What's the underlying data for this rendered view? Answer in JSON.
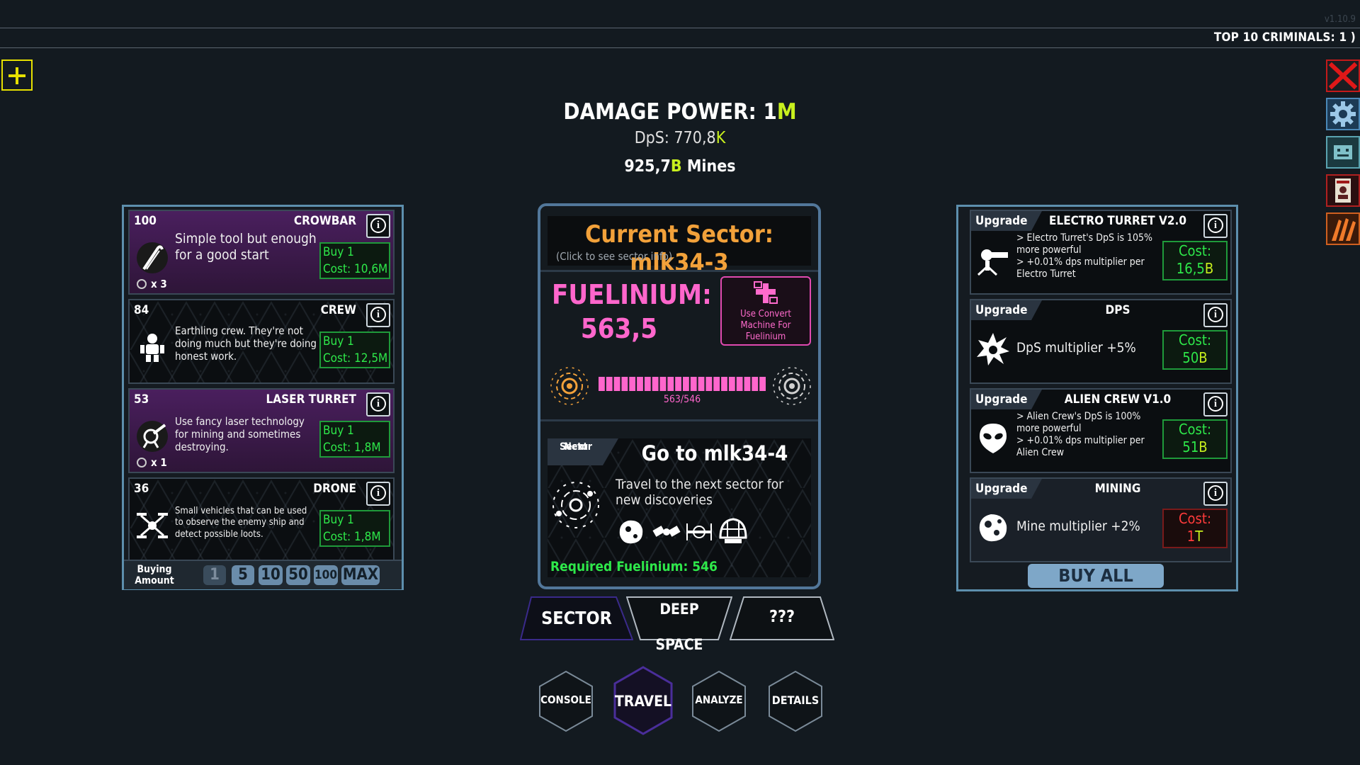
{
  "top_bar": {
    "version": "v1.10.9",
    "top_criminals": "TOP 10 CRIMINALS:  1 )"
  },
  "header": {
    "damage_power_label": "DAMAGE POWER: ",
    "damage_power_value": "1",
    "damage_power_suffix": "M",
    "dps_label": "DpS: ",
    "dps_value": "770,8",
    "dps_suffix": "K",
    "mines_value": "925,7",
    "mines_suffix": "B",
    "mines_label": " Mines"
  },
  "left_panel": {
    "units": [
      {
        "count": "100",
        "name": "CROWBAR",
        "desc": "Simple tool but enough for a good start",
        "buy": "Buy 1",
        "cost": "Cost: 10,6M",
        "multiplier": "x 3",
        "icon": "crowbar-icon"
      },
      {
        "count": "84",
        "name": "CREW",
        "desc": "Earthling crew. They're not doing much but they're doing honest work.",
        "buy": "Buy 1",
        "cost": "Cost: 12,5M",
        "icon": "crew-robot-icon"
      },
      {
        "count": "53",
        "name": "LASER TURRET",
        "desc": "Use fancy laser technology for mining and sometimes destroying.",
        "buy": "Buy 1",
        "cost": "Cost: 1,8M",
        "multiplier": "x 1",
        "icon": "laser-turret-icon"
      },
      {
        "count": "36",
        "name": "DRONE",
        "desc": "Small vehicles that can be used to observe the enemy ship and detect possible loots.",
        "buy": "Buy 1",
        "cost": "Cost: 1,8M",
        "icon": "drone-icon"
      }
    ],
    "buying_amount_label": "Buying Amount",
    "amounts": [
      "1",
      "5",
      "10",
      "50",
      "100",
      "MAX"
    ],
    "selected_amount": "1"
  },
  "center_panel": {
    "sector_title": "Current Sector: mlk34-3",
    "sector_hint": "(Click to see sector info)",
    "fuel_label": "FUELINIUM:",
    "fuel_value": "563,5",
    "convert_text": "Use Convert Machine For Fuelinium",
    "fuel_count": "563/546",
    "fuel_progress": 1.0,
    "next_label_1": "Next",
    "next_label_2": "Sector",
    "goto": "Go to mlk34-4",
    "travel_desc": "Travel to the next sector for new discoveries",
    "required": "Required Fuelinium: 546"
  },
  "tabs": {
    "sector": "SECTOR",
    "deep_1": "DEEP",
    "deep_2": "SPACE",
    "unknown": "???",
    "active": "sector"
  },
  "bottom_nav": {
    "console": "CONSOLE",
    "travel": "TRAVEL",
    "analyze": "ANALYZE",
    "details": "DETAILS",
    "active": "travel"
  },
  "right_panel": {
    "upgrades": [
      {
        "tag": "Upgrade",
        "name": "ELECTRO TURRET V2.0",
        "desc": "> Electro Turret's DpS is 105% more powerful\n> +0.01% dps multiplier per Electro Turret",
        "cost_label": "Cost:",
        "cost_value": "16,5",
        "cost_suffix": "B",
        "affordable": true,
        "icon": "electro-turret-icon"
      },
      {
        "tag": "Upgrade",
        "name": "DPS",
        "desc": "DpS multiplier +5%",
        "cost_label": "Cost:",
        "cost_value": "50",
        "cost_suffix": "B",
        "affordable": true,
        "icon": "explosion-icon"
      },
      {
        "tag": "Upgrade",
        "name": "ALIEN CREW V1.0",
        "desc": "> Alien Crew's DpS is 100% more powerful\n> +0.01% dps multiplier per Alien Crew",
        "cost_label": "Cost:",
        "cost_value": "51",
        "cost_suffix": "B",
        "affordable": true,
        "icon": "alien-icon"
      },
      {
        "tag": "Upgrade",
        "name": "MINING",
        "desc": "Mine multiplier +2%",
        "cost_label": "Cost:",
        "cost_value": "1",
        "cost_suffix": "T",
        "affordable": false,
        "icon": "asteroid-icon"
      }
    ],
    "buy_all": "BUY ALL"
  },
  "colors": {
    "accent_green": "#2ee84a",
    "fuel_pink": "#ff66cc",
    "sector_orange": "#f2a13a",
    "panel_border": "#5d8fad",
    "purple_card": "#3a1a48",
    "unaffordable_red": "#ff3b3b"
  },
  "icons": [
    "add-icon",
    "close-icon",
    "gear-icon",
    "screen-icon",
    "wanted-poster-icon",
    "claw-icon",
    "info-icon",
    "planet-icon",
    "satellite-icon"
  ]
}
